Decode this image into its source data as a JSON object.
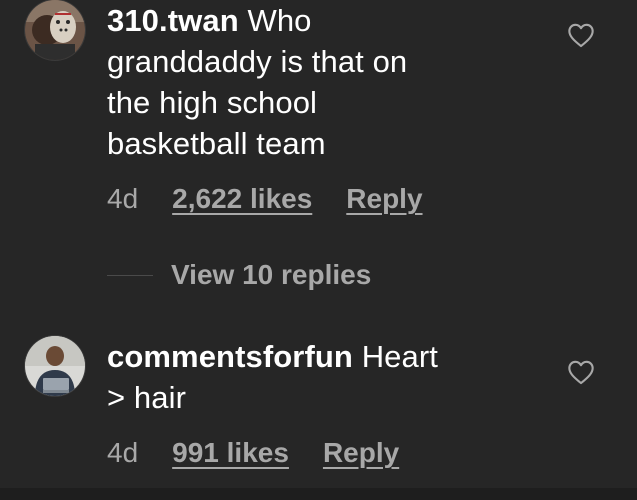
{
  "comments": [
    {
      "username": "310.twan",
      "text": "Who granddaddy is that on the high school basketball team",
      "text_lines": [
        "Who",
        "granddaddy is that on",
        "the high school",
        "basketball team"
      ],
      "time": "4d",
      "likes": "2,622 likes",
      "reply_label": "Reply",
      "icon": "heart-outline-icon"
    },
    {
      "username": "commentsforfun",
      "text": "Heart > hair",
      "text_lines": [
        "Heart",
        "> hair"
      ],
      "time": "4d",
      "likes": "991 likes",
      "reply_label": "Reply",
      "icon": "heart-outline-icon"
    }
  ],
  "view_replies_label": "View 10 replies",
  "colors": {
    "background": "#262626",
    "primary_text": "#ffffff",
    "secondary_text": "#a8a8a8"
  }
}
